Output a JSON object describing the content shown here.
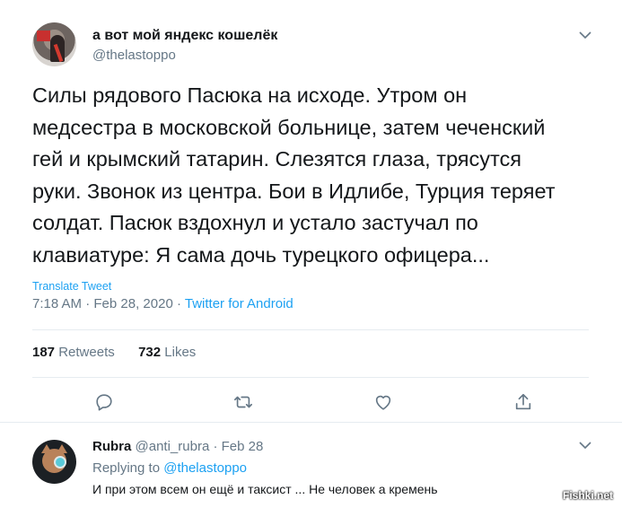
{
  "tweet": {
    "display_name": "а вот мой яндекс кошелёк",
    "handle": "@thelastoppo",
    "text": "Силы рядового Пасюка на исходе. Утром он\nмедсестра в московской больнице, затем чеченский\nгей и крымский татарин. Слезятся глаза, трясутся\nруки. Звонок из центра. Бои в Идлибе, Турция теряет\nсолдат. Пасюк вздохнул и устало застучал по\nклавиатуре: Я сама дочь турецкого офицера...",
    "translate_label": "Translate Tweet",
    "time": "7:18 AM",
    "separator": " · ",
    "date": "Feb 28, 2020",
    "source": "Twitter for Android",
    "retweets_count": "187",
    "retweets_label": "Retweets",
    "likes_count": "732",
    "likes_label": "Likes"
  },
  "actions": {
    "icons": [
      "reply-icon",
      "retweet-icon",
      "like-icon",
      "share-icon"
    ]
  },
  "reply": {
    "display_name": "Rubra",
    "handle": "@anti_rubra",
    "separator": " · ",
    "date": "Feb 28",
    "replying_label": "Replying to ",
    "replying_to": "@thelastoppo",
    "text": "И при этом всем он ещё и таксист ... Не человек а кремень"
  },
  "watermark": "Fishki.net",
  "colors": {
    "text": "#14171a",
    "secondary": "#657786",
    "link": "#1da1f2",
    "divider": "#e6ecf0"
  }
}
